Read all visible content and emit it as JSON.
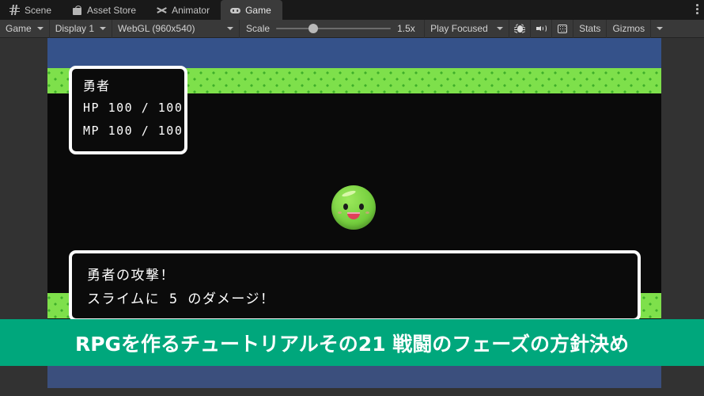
{
  "window": {
    "tabs": [
      {
        "label": "Scene",
        "icon": "grid-icon",
        "active": false
      },
      {
        "label": "Asset Store",
        "icon": "bag-icon",
        "active": false
      },
      {
        "label": "Animator",
        "icon": "animator-icon",
        "active": false
      },
      {
        "label": "Game",
        "icon": "goggles-icon",
        "active": true
      }
    ],
    "overflow_menu_icon": "kebab-menu-icon"
  },
  "toolbar": {
    "aspect_label": "Game",
    "display_label": "Display 1",
    "resolution_label": "WebGL (960x540)",
    "scale_label": "Scale",
    "scale_value": "1.5x",
    "scale_slider_percent": 28,
    "play_mode_label": "Play Focused",
    "buttons": [
      {
        "label": "Stats",
        "name": "stats-toggle"
      },
      {
        "label": "Gizmos",
        "name": "gizmos-dropdown"
      }
    ],
    "icons": [
      {
        "name": "bug-icon"
      },
      {
        "name": "mute-audio-icon"
      },
      {
        "name": "keyboard-shortcut-icon"
      }
    ]
  },
  "game": {
    "status_box": {
      "character_name": "勇者",
      "hp_line": "HP 100 / 100",
      "mp_line": "MP 100 / 100"
    },
    "message_box": {
      "line1": "勇者の攻撃！",
      "line2": "スライムに 5 のダメージ！"
    },
    "enemy": {
      "name": "slime-sprite"
    },
    "colors": {
      "sky": "#35528a",
      "sky_bottom": "#3b4f7d",
      "grass": "#7ee04b",
      "grass_detail": "#3fae2a",
      "void": "#0a0a0a",
      "slime_body": "#72cc3c",
      "slime_mouth": "#e0405a"
    }
  },
  "banner": {
    "text": "RPGを作るチュートリアルその21 戦闘のフェーズの方針決め",
    "background": "#00a77c",
    "text_color": "#ffffff"
  }
}
